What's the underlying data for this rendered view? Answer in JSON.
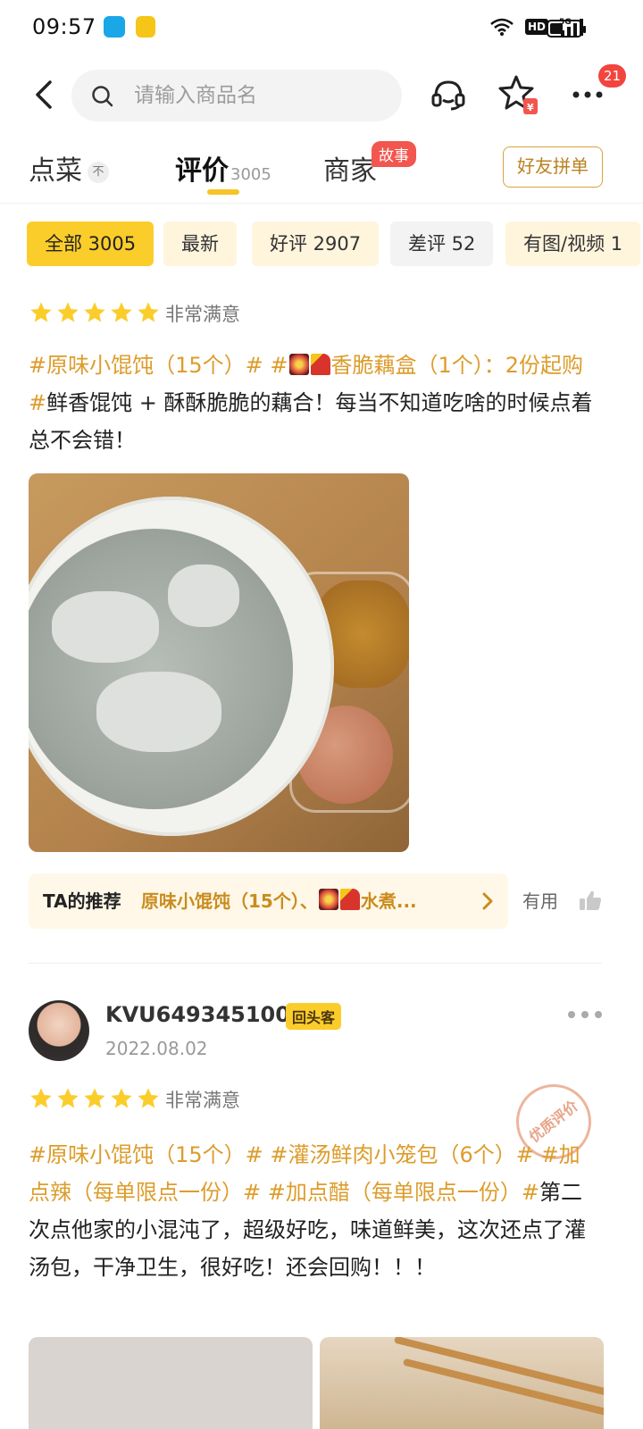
{
  "status_bar": {
    "time": "09:57",
    "hd": "HD",
    "network": "5G"
  },
  "header": {
    "search_placeholder": "请输入商品名",
    "more_badge": "21"
  },
  "tabs": {
    "dishes": "点菜",
    "dishes_icon_text": "不",
    "reviews": "评价",
    "reviews_count": "3005",
    "merchant": "商家",
    "story_tag": "故事",
    "group_button": "好友拼单"
  },
  "filters": [
    {
      "label": "全部 3005"
    },
    {
      "label": "最新"
    },
    {
      "label": "好评 2907"
    },
    {
      "label": "差评 52"
    },
    {
      "label": "有图/视频 1"
    }
  ],
  "review1": {
    "rating": 5,
    "satisfaction": "非常满意",
    "tag1": "#原味小馄饨（15个）#",
    "tag2_prefix": " #",
    "tag2_text": "香脆藕盒（1个）：2份起购#",
    "body": "鲜香馄饨 + 酥酥脆脆的藕合！每当不知道吃啥的时候点着总不会错！",
    "recommend_label": "TA的推荐",
    "recommend_text_a": "原味小馄饨（15个）、",
    "recommend_text_b": "水煮...",
    "useful": "有用"
  },
  "review2": {
    "username": "KVU649345100",
    "badge": "回头客",
    "date": "2022.08.02",
    "rating": 5,
    "satisfaction": "非常满意",
    "stamp": "优质评价",
    "tags": "#原味小馄饨（15个）# #灌汤鲜肉小笼包（6个）# #加点辣（每单限点一份）# #加点醋（每单限点一份）#",
    "body": "第二次点他家的小混沌了，超级好吃，味道鲜美，这次还点了灌汤包，干净卫生，很好吃！还会回购！！！"
  },
  "colors": {
    "accent": "#fbcd2b",
    "tag": "#dd9c2b",
    "badge_red": "#f2453d"
  }
}
